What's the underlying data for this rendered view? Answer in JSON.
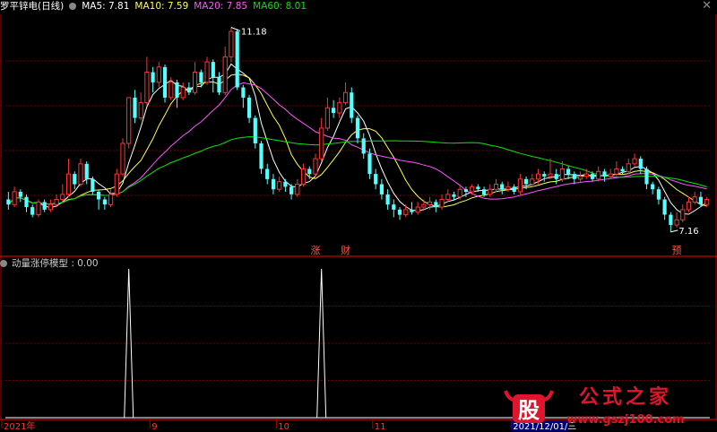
{
  "header": {
    "title": "罗平锌电(日线)",
    "ma5": "MA5: 7.81",
    "ma10": "MA10: 7.59",
    "ma20": "MA20: 7.85",
    "ma60": "MA60: 8.01",
    "close_icon": "close-icon"
  },
  "indicator": {
    "title": "动量涨停模型 : 0.00"
  },
  "colors": {
    "up": "#ff3232",
    "down": "#54ffff",
    "ma5": "#ffffff",
    "ma10": "#ffff54",
    "ma20": "#ff54ff",
    "ma60": "#00e600",
    "axis": "#b00000",
    "grid": "#8b0000",
    "marker": "#ff5a3c",
    "watermark": "#e0142c"
  },
  "markers": [
    {
      "text": "涨"
    },
    {
      "text": "财"
    },
    {
      "text": "预"
    }
  ],
  "annotations": {
    "high": "11.18",
    "low": "7.16"
  },
  "time_axis": {
    "labels": [
      "2021年",
      "9",
      "10",
      "11",
      "2021/12/01/三"
    ]
  },
  "watermark": {
    "logo": "股",
    "text": "公式之家",
    "url": "www.gszj100.com"
  },
  "chart_data": {
    "type": "candlestick",
    "symbol": "罗平锌电",
    "period": "日线",
    "candles": [
      [
        7.8,
        7.7,
        7.95,
        7.6
      ],
      [
        7.7,
        7.95,
        8.05,
        7.65
      ],
      [
        7.95,
        7.85,
        8.0,
        7.75
      ],
      [
        7.85,
        7.65,
        7.9,
        7.55
      ],
      [
        7.65,
        7.5,
        7.7,
        7.45
      ],
      [
        7.5,
        7.75,
        7.8,
        7.45
      ],
      [
        7.75,
        7.6,
        7.8,
        7.55
      ],
      [
        7.6,
        7.7,
        7.8,
        7.55
      ],
      [
        7.7,
        7.8,
        7.9,
        7.65
      ],
      [
        7.8,
        7.9,
        8.1,
        7.75
      ],
      [
        7.9,
        8.3,
        8.6,
        7.85
      ],
      [
        8.3,
        8.1,
        8.35,
        8.0
      ],
      [
        8.1,
        8.5,
        8.6,
        8.05
      ],
      [
        8.5,
        8.2,
        8.55,
        8.1
      ],
      [
        8.2,
        7.95,
        8.25,
        7.9
      ],
      [
        7.95,
        7.8,
        8.0,
        7.6
      ],
      [
        7.8,
        7.7,
        7.85,
        7.6
      ],
      [
        7.7,
        7.9,
        8.0,
        7.65
      ],
      [
        7.9,
        8.3,
        8.4,
        7.85
      ],
      [
        8.3,
        8.9,
        9.0,
        8.25
      ],
      [
        8.9,
        9.8,
        9.8,
        8.8
      ],
      [
        9.8,
        9.4,
        9.95,
        9.3
      ],
      [
        9.4,
        9.7,
        9.9,
        9.35
      ],
      [
        9.7,
        10.3,
        10.6,
        9.65
      ],
      [
        10.3,
        10.1,
        10.4,
        9.9
      ],
      [
        10.1,
        10.4,
        10.5,
        10.0
      ],
      [
        10.4,
        9.8,
        10.45,
        9.7
      ],
      [
        9.8,
        10.1,
        10.2,
        9.75
      ],
      [
        10.1,
        9.8,
        10.15,
        9.6
      ],
      [
        9.8,
        10.0,
        10.1,
        9.75
      ],
      [
        10.0,
        9.9,
        10.1,
        9.85
      ],
      [
        9.9,
        10.3,
        10.5,
        9.85
      ],
      [
        10.3,
        10.1,
        10.35,
        10.0
      ],
      [
        10.1,
        10.5,
        10.6,
        10.05
      ],
      [
        10.5,
        10.2,
        10.55,
        9.9
      ],
      [
        10.2,
        9.9,
        10.3,
        9.85
      ],
      [
        9.9,
        10.6,
        10.8,
        9.85
      ],
      [
        10.6,
        11.1,
        11.18,
        10.5
      ],
      [
        11.1,
        10.0,
        11.15,
        9.95
      ],
      [
        10.0,
        9.8,
        10.05,
        9.6
      ],
      [
        9.8,
        9.4,
        9.85,
        9.3
      ],
      [
        9.4,
        8.9,
        9.45,
        8.8
      ],
      [
        8.9,
        8.4,
        8.95,
        8.3
      ],
      [
        8.4,
        8.2,
        8.5,
        8.1
      ],
      [
        8.2,
        8.0,
        8.3,
        7.9
      ],
      [
        8.0,
        8.15,
        8.25,
        7.95
      ],
      [
        8.15,
        8.05,
        8.2,
        7.95
      ],
      [
        8.05,
        7.9,
        8.1,
        7.8
      ],
      [
        7.9,
        8.1,
        8.2,
        7.85
      ],
      [
        8.1,
        8.4,
        8.5,
        8.05
      ],
      [
        8.4,
        8.3,
        8.45,
        8.2
      ],
      [
        8.3,
        8.6,
        8.7,
        8.25
      ],
      [
        8.6,
        9.2,
        9.4,
        8.55
      ],
      [
        9.2,
        9.6,
        9.8,
        9.15
      ],
      [
        9.6,
        9.5,
        9.75,
        9.4
      ],
      [
        9.5,
        9.7,
        9.8,
        9.4
      ],
      [
        9.7,
        9.9,
        10.1,
        9.65
      ],
      [
        9.9,
        9.4,
        10.0,
        9.3
      ],
      [
        9.4,
        9.0,
        9.45,
        8.9
      ],
      [
        9.0,
        8.7,
        9.1,
        8.6
      ],
      [
        8.7,
        8.3,
        8.8,
        8.2
      ],
      [
        8.3,
        8.1,
        8.4,
        8.0
      ],
      [
        8.1,
        7.9,
        8.2,
        7.8
      ],
      [
        7.9,
        7.7,
        8.0,
        7.6
      ],
      [
        7.7,
        7.6,
        7.8,
        7.45
      ],
      [
        7.6,
        7.5,
        7.65,
        7.4
      ],
      [
        7.5,
        7.6,
        7.7,
        7.45
      ],
      [
        7.6,
        7.55,
        7.75,
        7.5
      ],
      [
        7.55,
        7.65,
        7.75,
        7.5
      ],
      [
        7.65,
        7.7,
        7.8,
        7.6
      ],
      [
        7.7,
        7.75,
        7.85,
        7.6
      ],
      [
        7.75,
        7.65,
        7.8,
        7.55
      ],
      [
        7.65,
        7.8,
        7.9,
        7.6
      ],
      [
        7.8,
        7.9,
        8.0,
        7.75
      ],
      [
        7.9,
        7.85,
        7.95,
        7.8
      ],
      [
        7.85,
        8.0,
        8.1,
        7.8
      ],
      [
        8.0,
        7.95,
        8.05,
        7.85
      ],
      [
        7.95,
        8.05,
        8.1,
        7.9
      ],
      [
        8.05,
        8.0,
        8.1,
        7.95
      ],
      [
        8.0,
        7.9,
        8.05,
        7.85
      ],
      [
        7.9,
        8.0,
        8.1,
        7.85
      ],
      [
        8.0,
        8.1,
        8.2,
        7.95
      ],
      [
        8.1,
        8.0,
        8.15,
        7.9
      ],
      [
        8.0,
        8.05,
        8.15,
        7.95
      ],
      [
        8.05,
        7.95,
        8.1,
        7.9
      ],
      [
        7.95,
        8.2,
        8.3,
        7.9
      ],
      [
        8.2,
        8.1,
        8.25,
        8.0
      ],
      [
        8.1,
        8.2,
        8.3,
        8.05
      ],
      [
        8.2,
        8.3,
        8.4,
        8.1
      ],
      [
        8.3,
        8.25,
        8.35,
        8.15
      ],
      [
        8.25,
        8.3,
        8.6,
        8.2
      ],
      [
        8.3,
        8.2,
        8.4,
        8.1
      ],
      [
        8.2,
        8.4,
        8.55,
        8.15
      ],
      [
        8.4,
        8.3,
        8.45,
        8.2
      ],
      [
        8.3,
        8.2,
        8.35,
        8.1
      ],
      [
        8.2,
        8.25,
        8.35,
        8.15
      ],
      [
        8.25,
        8.3,
        8.4,
        8.2
      ],
      [
        8.3,
        8.2,
        8.35,
        8.15
      ],
      [
        8.2,
        8.35,
        8.45,
        8.15
      ],
      [
        8.35,
        8.25,
        8.4,
        8.15
      ],
      [
        8.25,
        8.3,
        8.4,
        8.2
      ],
      [
        8.3,
        8.4,
        8.55,
        8.25
      ],
      [
        8.4,
        8.35,
        8.45,
        8.3
      ],
      [
        8.35,
        8.5,
        8.6,
        8.3
      ],
      [
        8.5,
        8.6,
        8.7,
        8.45
      ],
      [
        8.6,
        8.4,
        8.65,
        8.3
      ],
      [
        8.4,
        8.1,
        8.45,
        8.0
      ],
      [
        8.1,
        8.0,
        8.15,
        7.9
      ],
      [
        8.0,
        7.8,
        8.05,
        7.7
      ],
      [
        7.8,
        7.5,
        7.85,
        7.4
      ],
      [
        7.5,
        7.3,
        7.55,
        7.16
      ],
      [
        7.3,
        7.4,
        7.55,
        7.25
      ],
      [
        7.4,
        7.6,
        7.7,
        7.35
      ],
      [
        7.6,
        7.75,
        7.85,
        7.55
      ],
      [
        7.75,
        7.85,
        7.95,
        7.7
      ],
      [
        7.85,
        7.7,
        7.95,
        7.65
      ],
      [
        7.7,
        7.8,
        7.85,
        7.65
      ]
    ],
    "ma_lengths": [
      5,
      10,
      20,
      60
    ],
    "ylim": [
      7.0,
      11.4
    ],
    "indicator": {
      "name": "动量涨停模型",
      "spikes": [
        {
          "index": 20,
          "value": 1
        },
        {
          "index": 52,
          "value": 1
        }
      ],
      "ylim": [
        0,
        1
      ]
    },
    "marker_positions": [
      {
        "index": 51,
        "text": "涨"
      },
      {
        "index": 56,
        "text": "财"
      },
      {
        "index": 111,
        "text": "预"
      }
    ],
    "time_label_indices": [
      0,
      24,
      45,
      61,
      84
    ]
  }
}
